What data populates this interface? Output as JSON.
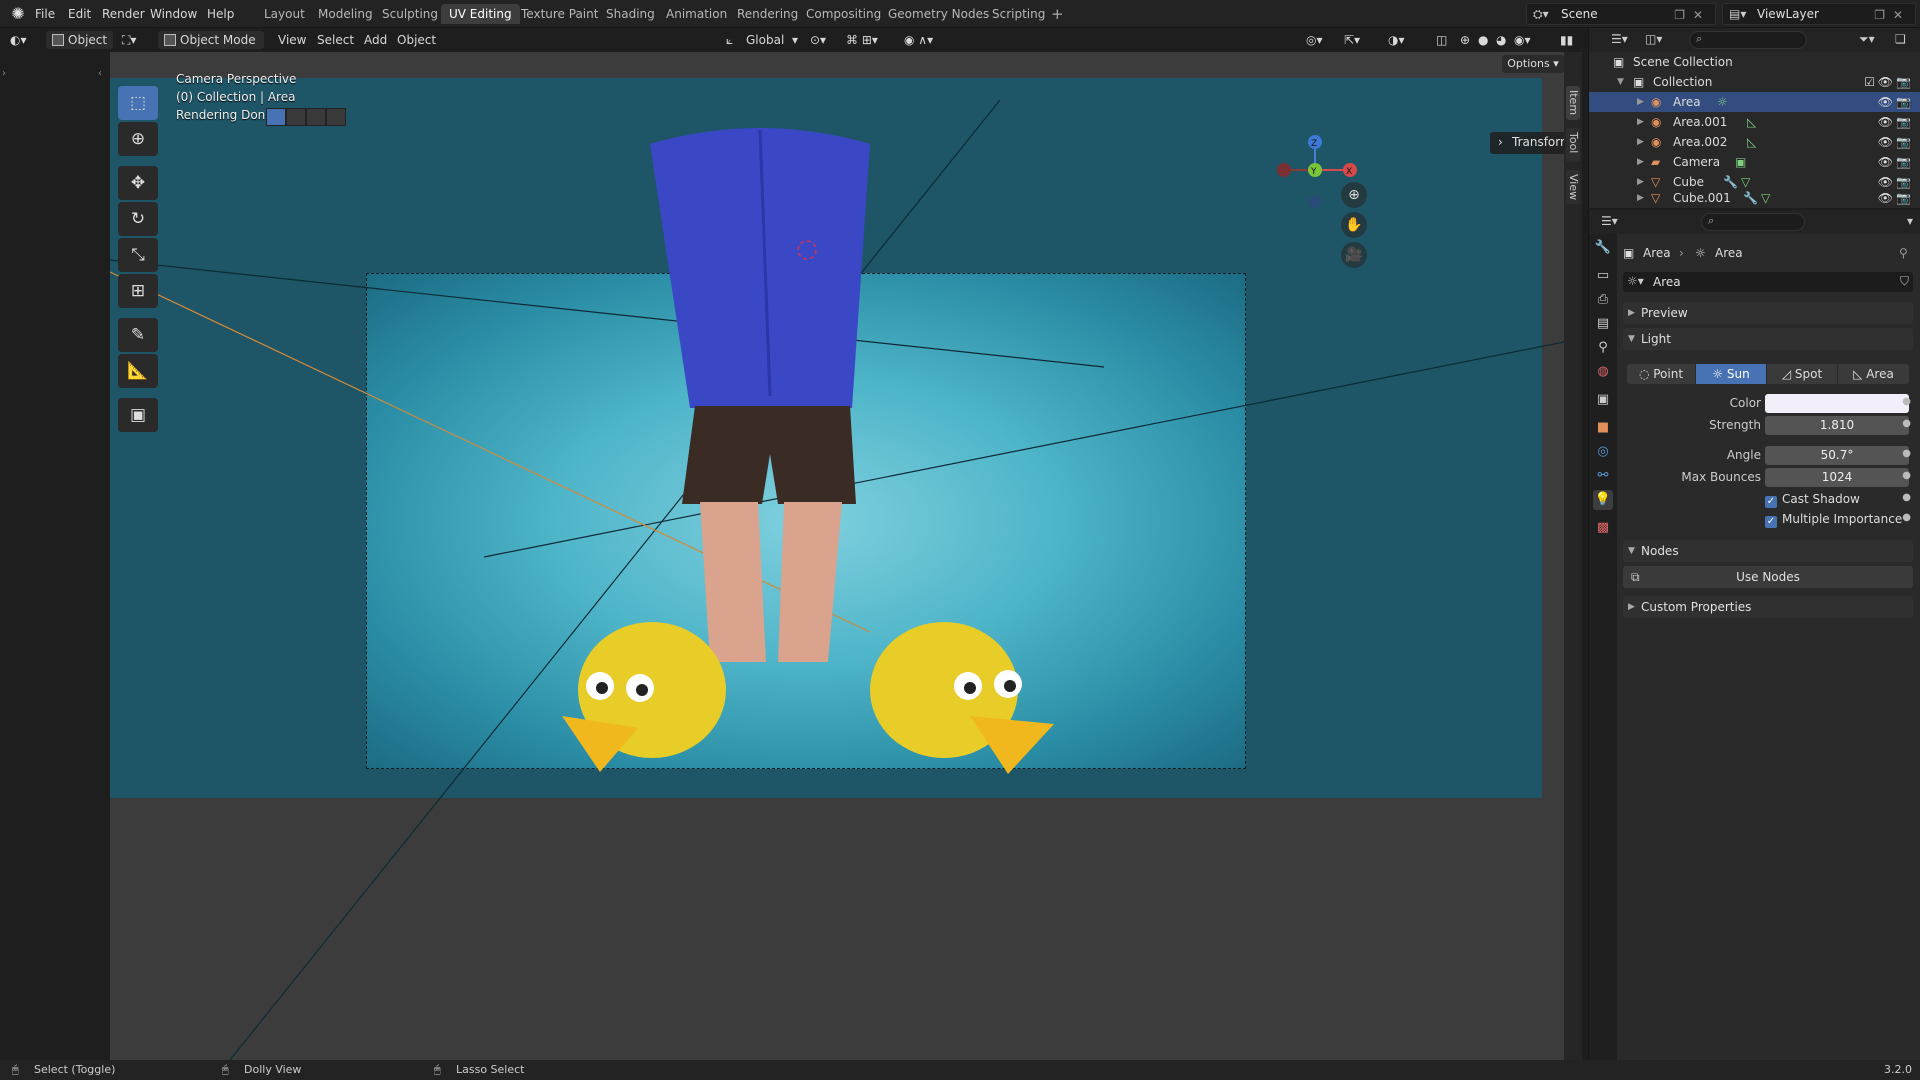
{
  "app": {
    "menus": [
      "File",
      "Edit",
      "Render",
      "Window",
      "Help"
    ],
    "workspaces": [
      "Layout",
      "Modeling",
      "Sculpting",
      "UV Editing",
      "Texture Paint",
      "Shading",
      "Animation",
      "Rendering",
      "Compositing",
      "Geometry Nodes",
      "Scripting"
    ],
    "active_workspace": "UV Editing",
    "scene_name": "Scene",
    "view_layer": "ViewLayer"
  },
  "viewport_header": {
    "object_label": "Object",
    "mode": "Object Mode",
    "menus": [
      "View",
      "Select",
      "Add",
      "Object"
    ],
    "transform_orientation": "Global",
    "options_label": "Options"
  },
  "viewport": {
    "overlay_lines": [
      "Camera Perspective",
      "(0) Collection | Area",
      "Rendering Done"
    ],
    "transform_panel": "Transform",
    "gizmo_axes": {
      "z": "Z",
      "y": "Y",
      "x": "X"
    },
    "side_tabs": [
      "Item",
      "Tool",
      "View"
    ]
  },
  "outliner": {
    "root": "Scene Collection",
    "collection": "Collection",
    "items": [
      {
        "name": "Area",
        "selected": true
      },
      {
        "name": "Area.001",
        "selected": false
      },
      {
        "name": "Area.002",
        "selected": false
      },
      {
        "name": "Camera",
        "selected": false
      },
      {
        "name": "Cube",
        "selected": false
      },
      {
        "name": "Cube.001",
        "selected": false
      }
    ]
  },
  "properties": {
    "breadcrumb_object": "Area",
    "breadcrumb_data": "Area",
    "datablock_name": "Area",
    "panels": {
      "preview": "Preview",
      "light": "Light",
      "nodes": "Nodes",
      "custom_properties": "Custom Properties"
    },
    "light_types": [
      "Point",
      "Sun",
      "Spot",
      "Area"
    ],
    "active_light_type": "Sun",
    "fields": {
      "color_label": "Color",
      "color_value": "#f2eefa",
      "strength_label": "Strength",
      "strength_value": "1.810",
      "angle_label": "Angle",
      "angle_value": "50.7°",
      "max_bounces_label": "Max Bounces",
      "max_bounces_value": "1024",
      "cast_shadow_label": "Cast Shadow",
      "multiple_importance_label": "Multiple Importance"
    },
    "use_nodes_label": "Use Nodes"
  },
  "statusbar": {
    "left": "Select (Toggle)",
    "middle": "Dolly View",
    "right_action": "Lasso Select",
    "version": "3.2.0"
  },
  "colors": {
    "accent": "#4772b3",
    "selected_row": "#334d80",
    "render_bg": "#1e5567"
  }
}
